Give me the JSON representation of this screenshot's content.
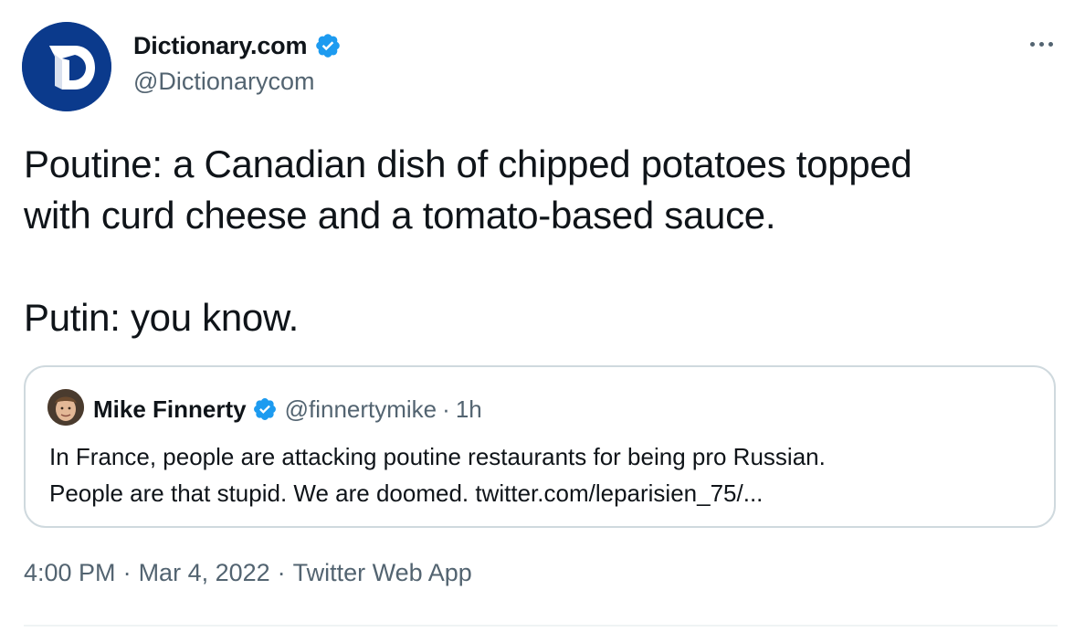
{
  "author": {
    "name": "Dictionary.com",
    "handle": "@Dictionarycom",
    "verified": true
  },
  "tweet": {
    "text": "Poutine: a Canadian dish of chipped potatoes topped\nwith curd cheese and a tomato-based sauce.\n\nPutin: you know."
  },
  "quoted_tweet": {
    "name": "Mike Finnerty",
    "handle": "@finnertymike",
    "separator": "·",
    "time": "1h",
    "text": "In France, people are attacking poutine restaurants for being pro Russian.\nPeople are that stupid. We are doomed. twitter.com/leparisien_75/..."
  },
  "meta": {
    "time": "4:00 PM",
    "separator": "·",
    "date": "Mar 4, 2022",
    "source": "Twitter Web App"
  },
  "colors": {
    "brand_blue": "#0b3a8c",
    "verified_blue": "#1d9bf0",
    "secondary_text": "#536471",
    "border": "#cfd9de"
  },
  "icons": {
    "avatar": "dictionary-logo-icon",
    "verified": "verified-badge-icon",
    "more": "more-dots-icon"
  }
}
